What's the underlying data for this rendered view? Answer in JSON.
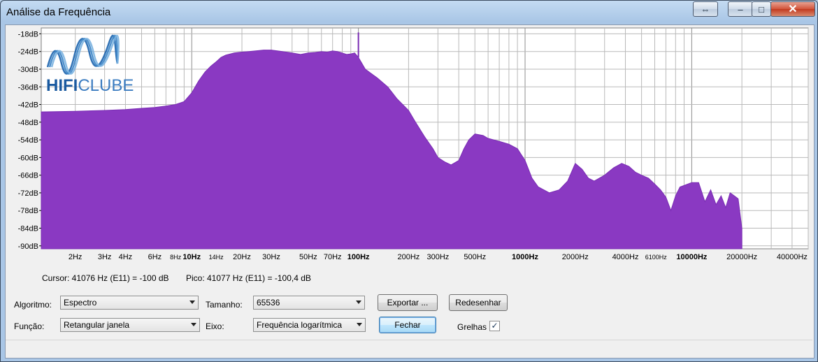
{
  "window": {
    "title": "Análise da Frequência",
    "restore_glyph": "⇔",
    "minimize_glyph": "–",
    "maximize_glyph": "□",
    "close_glyph": "✕"
  },
  "logo": {
    "text_a": "HIFI",
    "text_b": "CLUBE"
  },
  "colors": {
    "spectrum_fill": "#8a39c2",
    "spectrum_edge": "#7a2db4",
    "grid": "#b9b9b9"
  },
  "chart_data": {
    "type": "area",
    "x_scale": "log",
    "xlim": [
      1.25,
      50000
    ],
    "ylim": [
      -91,
      -16
    ],
    "y_ticks": [
      "-18dB",
      "-24dB",
      "-30dB",
      "-36dB",
      "-42dB",
      "-48dB",
      "-54dB",
      "-60dB",
      "-66dB",
      "-72dB",
      "-78dB",
      "-84dB",
      "-90dB"
    ],
    "y_tick_values": [
      -18,
      -24,
      -30,
      -36,
      -42,
      -48,
      -54,
      -60,
      -66,
      -72,
      -78,
      -84,
      -90
    ],
    "x_ticks": [
      {
        "label": "2Hz",
        "value": 2
      },
      {
        "label": "3Hz",
        "value": 3
      },
      {
        "label": "4Hz",
        "value": 4
      },
      {
        "label": "6Hz",
        "value": 6
      },
      {
        "label": "8Hz",
        "value": 8,
        "small": true
      },
      {
        "label": "10Hz",
        "value": 10,
        "bold": true
      },
      {
        "label": "14Hz",
        "value": 14,
        "small": true
      },
      {
        "label": "20Hz",
        "value": 20
      },
      {
        "label": "30Hz",
        "value": 30
      },
      {
        "label": "50Hz",
        "value": 50
      },
      {
        "label": "70Hz",
        "value": 70
      },
      {
        "label": "100Hz",
        "value": 100,
        "bold": true
      },
      {
        "label": "200Hz",
        "value": 200
      },
      {
        "label": "300Hz",
        "value": 300
      },
      {
        "label": "500Hz",
        "value": 500
      },
      {
        "label": "1000Hz",
        "value": 1000,
        "bold": true
      },
      {
        "label": "2000Hz",
        "value": 2000
      },
      {
        "label": "4000Hz",
        "value": 4000
      },
      {
        "label": "6100Hz",
        "value": 6100,
        "small": true
      },
      {
        "label": "10000Hz",
        "value": 10000,
        "bold": true
      },
      {
        "label": "20000Hz",
        "value": 20000
      },
      {
        "label": "40000Hz",
        "value": 40000
      }
    ],
    "series": [
      {
        "x": [
          1.25,
          2,
          3,
          4,
          5,
          6,
          7,
          8,
          9,
          10,
          11,
          12,
          13,
          14,
          15,
          16,
          18,
          20,
          22,
          24,
          27,
          30,
          35,
          40,
          45,
          50,
          55,
          60,
          65,
          70,
          75,
          80,
          85,
          90,
          95,
          100,
          110,
          130,
          150,
          170,
          200,
          220,
          250,
          280,
          300,
          330,
          360,
          400,
          430,
          460,
          500,
          560,
          600,
          700,
          800,
          900,
          1000,
          1100,
          1200,
          1400,
          1600,
          1800,
          2000,
          2200,
          2400,
          2600,
          3000,
          3400,
          3800,
          4200,
          4600,
          5000,
          5500,
          6000,
          6500,
          7000,
          7500,
          8000,
          8500,
          9000,
          10000,
          11000,
          12000,
          13000,
          14000,
          15000,
          16000,
          17000,
          18000,
          19000,
          20000
        ],
        "y": [
          -44.5,
          -44.3,
          -44,
          -43.7,
          -43.3,
          -43,
          -42.5,
          -42,
          -41,
          -38,
          -34,
          -31,
          -29,
          -27.5,
          -26,
          -25.2,
          -24.5,
          -24.2,
          -24,
          -23.8,
          -23.5,
          -23.5,
          -24,
          -24.5,
          -25,
          -24.5,
          -24.3,
          -24,
          -24.2,
          -23.8,
          -24,
          -24.5,
          -25,
          -24.8,
          -24.5,
          -26,
          -30,
          -33,
          -36,
          -40,
          -44,
          -48,
          -53,
          -57,
          -60,
          -61.5,
          -62.5,
          -61,
          -57,
          -54,
          -52,
          -52.5,
          -53.5,
          -54.5,
          -55.5,
          -57,
          -61,
          -67,
          -70,
          -72,
          -71,
          -68,
          -62,
          -64,
          -67,
          -68,
          -66,
          -63.5,
          -62,
          -63,
          -65,
          -66,
          -67,
          -69,
          -71,
          -73.5,
          -78,
          -73,
          -70,
          -69.5,
          -68.5,
          -68.5,
          -75,
          -71,
          -76,
          -73,
          -77,
          -72,
          -73,
          -74,
          -84
        ]
      }
    ]
  },
  "status": {
    "cursor": "Cursor: 41076 Hz (E11) = -100 dB",
    "peak": "Pico: 41077 Hz (E11) = -100,4 dB"
  },
  "controls": {
    "algorithm_label": "Algoritmo:",
    "algorithm_value": "Espectro",
    "size_label": "Tamanho:",
    "size_value": "65536",
    "export_button": "Exportar ...",
    "redraw_button": "Redesenhar",
    "function_label": "Função:",
    "function_value": "Retangular janela",
    "axis_label": "Eixo:",
    "axis_value": "Frequência logarítmica",
    "close_button": "Fechar",
    "grids_label": "Grelhas",
    "grids_checked": "✓"
  }
}
